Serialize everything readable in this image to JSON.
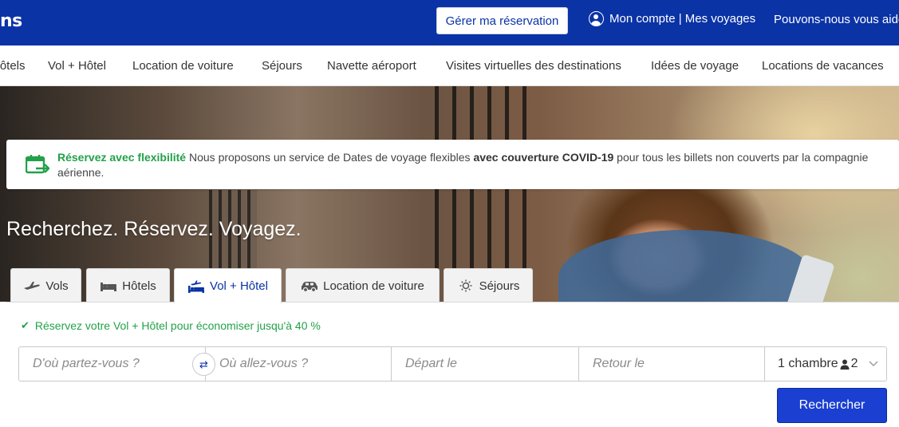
{
  "header": {
    "logo_text": "ns",
    "manage_booking": "Gérer ma réservation",
    "account": "Mon compte | Mes voyages",
    "help": "Pouvons-nous vous aider ?"
  },
  "nav": {
    "items": [
      "Hôtels",
      "Vol + Hôtel",
      "Location de voiture",
      "Séjours",
      "Navette aéroport",
      "Visites virtuelles des destinations",
      "Idées de voyage",
      "Locations de vacances"
    ]
  },
  "notice": {
    "highlight": "Réservez avec flexibilité",
    "text1": " Nous proposons un service de Dates de voyage flexibles ",
    "bold": "avec couverture COVID-19",
    "text2": " pour tous les billets non couverts par la compagnie aérienne."
  },
  "hero": {
    "headline": "Recherchez. Réservez. Voyagez."
  },
  "tabs": [
    {
      "label": "Vols",
      "icon": "plane-icon"
    },
    {
      "label": "Hôtels",
      "icon": "bed-icon"
    },
    {
      "label": "Vol + Hôtel",
      "icon": "plane-bed-icon",
      "active": true
    },
    {
      "label": "Location de voiture",
      "icon": "car-icon"
    },
    {
      "label": "Séjours",
      "icon": "sun-icon"
    }
  ],
  "search": {
    "promo": "Réservez votre Vol + Hôtel pour économiser jusqu'à 40 %",
    "origin_placeholder": "D'où partez-vous ?",
    "destination_placeholder": "Où allez-vous ?",
    "depart_placeholder": "Départ le",
    "return_placeholder": "Retour le",
    "rooms_label": "1 chambre",
    "guests": "2",
    "submit": "Rechercher"
  },
  "colors": {
    "brand": "#0a33a6",
    "button": "#1a3fd1",
    "success": "#23a14a"
  }
}
